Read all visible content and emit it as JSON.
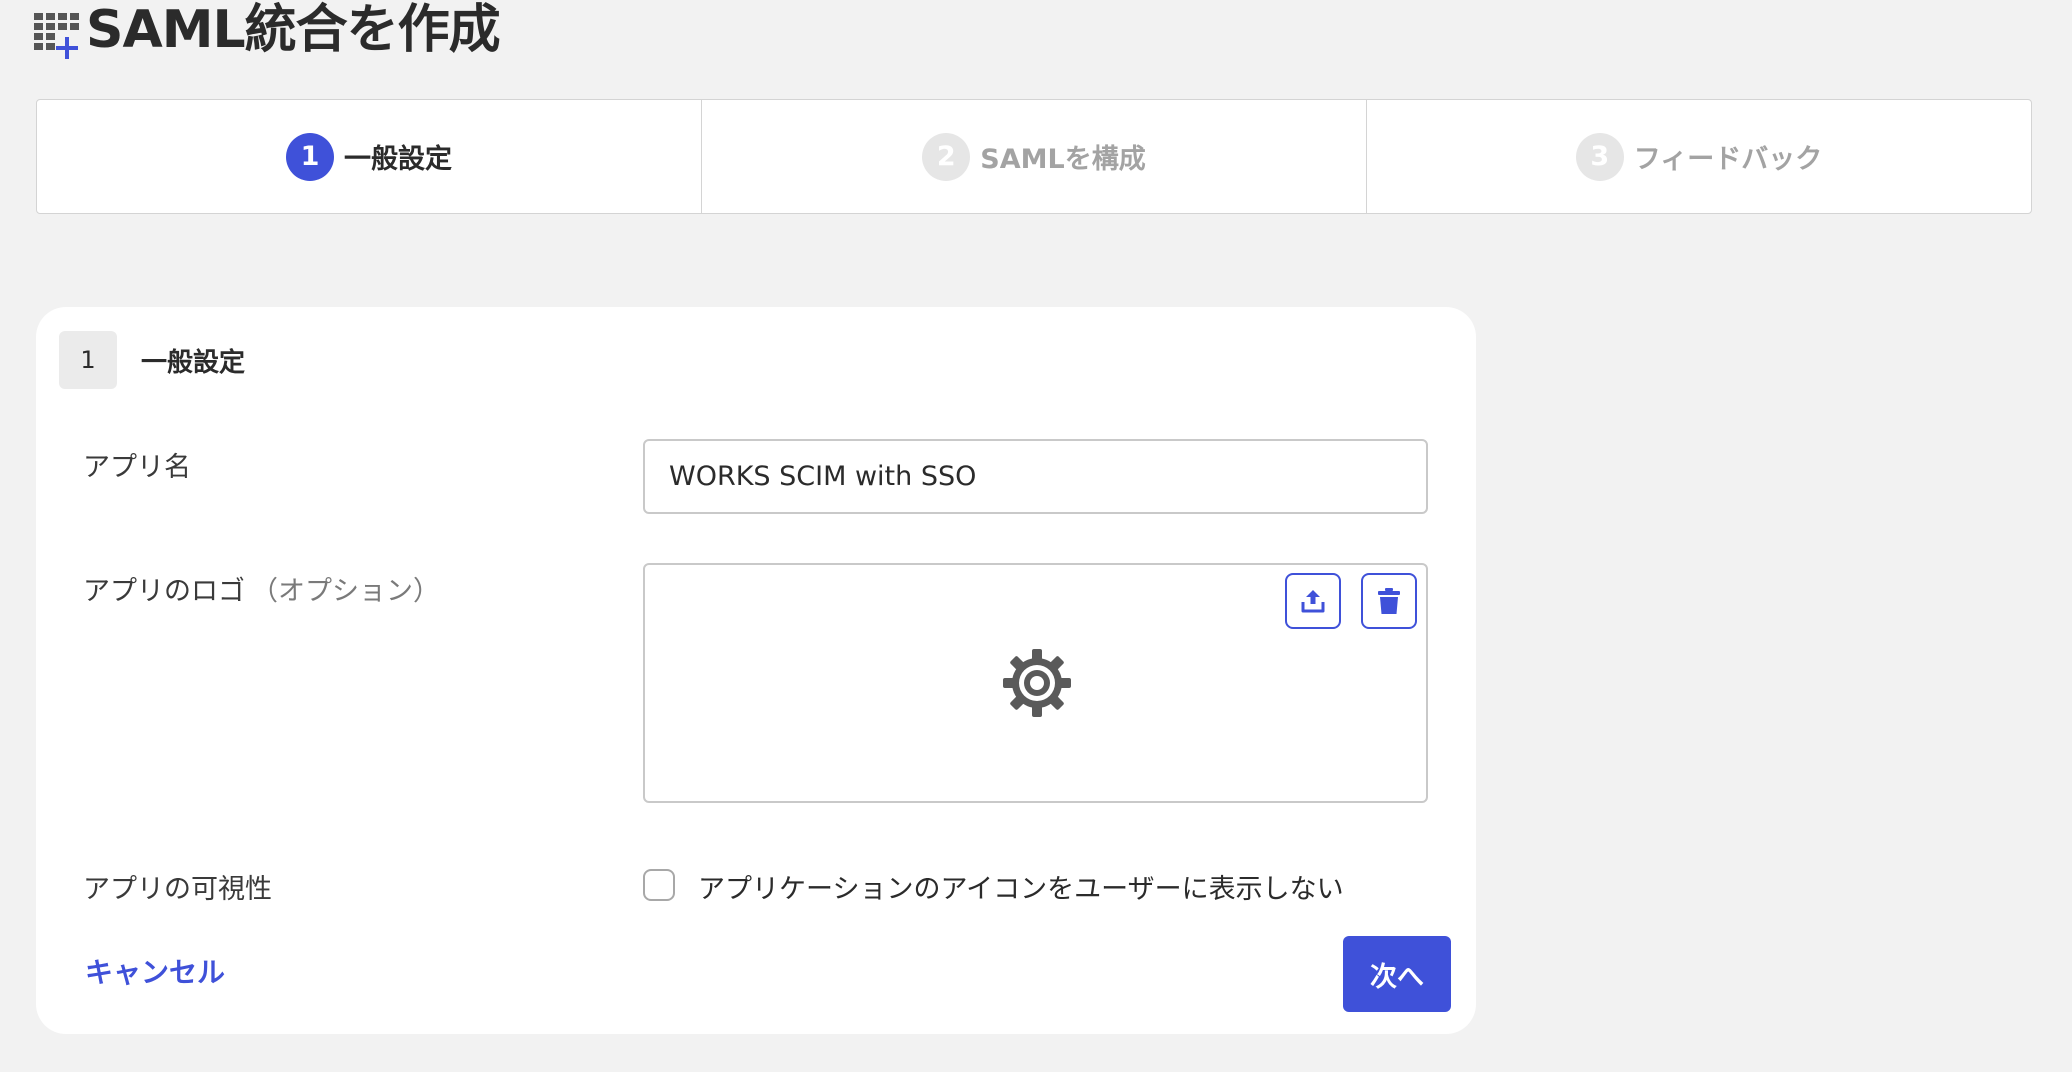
{
  "header": {
    "title": "SAML統合を作成",
    "icon": "grid-add-icon"
  },
  "stepper": {
    "steps": [
      {
        "number": "1",
        "label": "一般設定",
        "active": true
      },
      {
        "number": "2",
        "label": "SAMLを構成",
        "active": false
      },
      {
        "number": "3",
        "label": "フィードバック",
        "active": false
      }
    ]
  },
  "section": {
    "number": "1",
    "title": "一般設定"
  },
  "form": {
    "app_name": {
      "label": "アプリ名",
      "value": "WORKS SCIM with SSO"
    },
    "app_logo": {
      "label": "アプリのロゴ",
      "optional": "（オプション）",
      "placeholder_icon": "gear-icon"
    },
    "visibility": {
      "label": "アプリの可視性",
      "checkbox_label": "アプリケーションのアイコンをユーザーに表示しない",
      "checked": false
    }
  },
  "actions": {
    "cancel_label": "キャンセル",
    "next_label": "次へ"
  },
  "colors": {
    "accent": "#3f51d9",
    "background": "#f2f2f2",
    "inactive_step": "#a3a3a3"
  }
}
